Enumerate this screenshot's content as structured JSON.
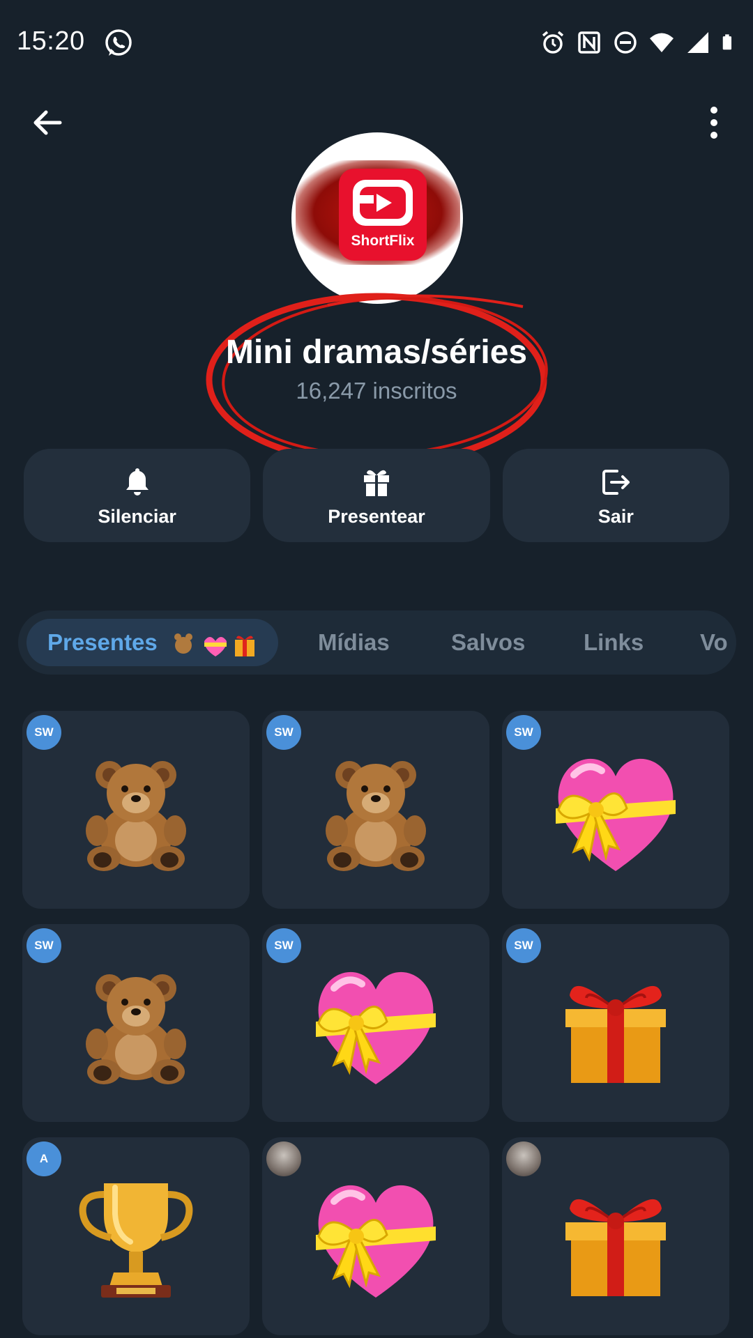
{
  "status_bar": {
    "time": "15:20"
  },
  "channel": {
    "avatar_logo_text": "ShortFlix",
    "name": "Mini dramas/séries",
    "subscribers": "16,247 inscritos"
  },
  "actions": [
    {
      "label": "Silenciar",
      "icon": "bell-icon"
    },
    {
      "label": "Presentear",
      "icon": "gift-icon"
    },
    {
      "label": "Sair",
      "icon": "exit-icon"
    }
  ],
  "tabs": [
    {
      "label": "Presentes",
      "active": true
    },
    {
      "label": "Mídias"
    },
    {
      "label": "Salvos"
    },
    {
      "label": "Links"
    },
    {
      "label": "Vo"
    }
  ],
  "gifts": [
    {
      "item": "teddy-bear",
      "badge": "SW"
    },
    {
      "item": "teddy-bear",
      "badge": "SW"
    },
    {
      "item": "heart-with-ribbon",
      "badge": "SW"
    },
    {
      "item": "teddy-bear",
      "badge": "SW"
    },
    {
      "item": "heart-with-ribbon",
      "badge": "SW"
    },
    {
      "item": "wrapped-gift",
      "badge": "SW"
    },
    {
      "item": "trophy",
      "badge": "A"
    },
    {
      "item": "heart-with-ribbon",
      "badge": ""
    },
    {
      "item": "wrapped-gift",
      "badge": ""
    }
  ],
  "colors": {
    "background": "#17212b",
    "card": "#222d3a",
    "accent": "#5fa8e8",
    "badge": "#4a90d9",
    "annotation_red": "#e0201a"
  }
}
